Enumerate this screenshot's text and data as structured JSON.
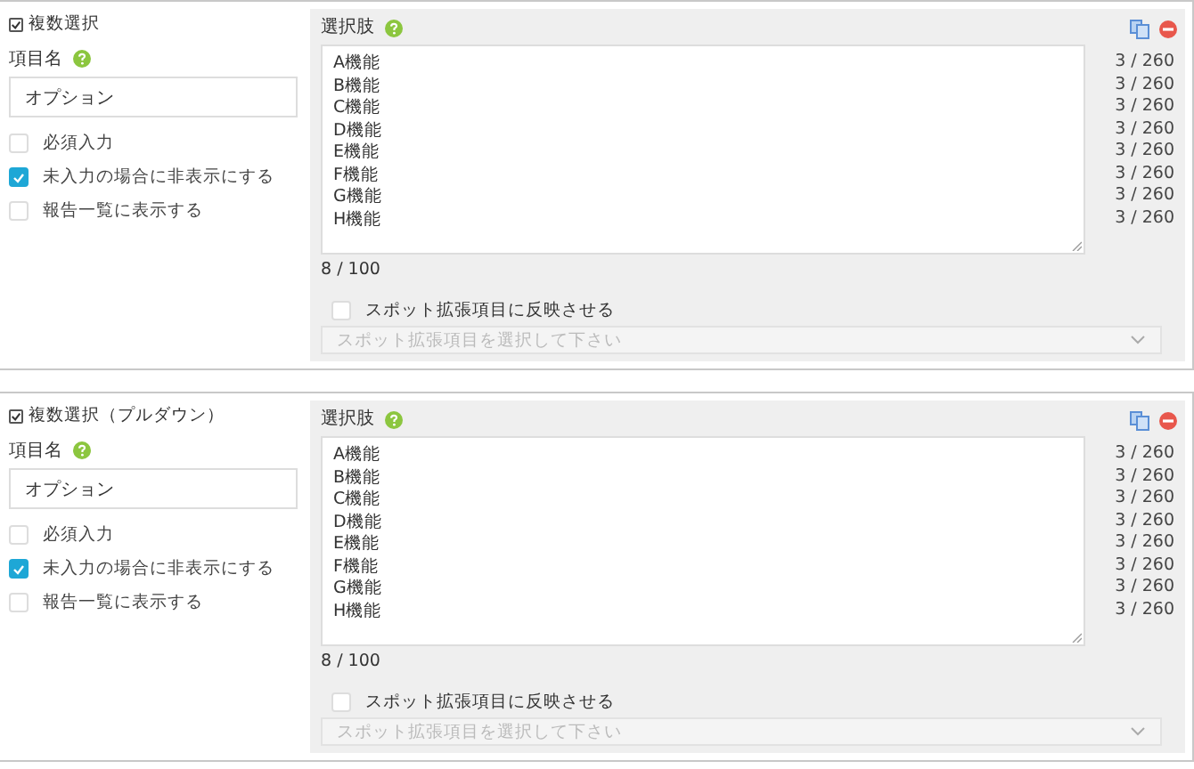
{
  "cards": [
    {
      "heading": {
        "label": "複数選択",
        "checked": true
      },
      "name_label": "項目名",
      "name_value": "オプション",
      "options_flags": [
        {
          "label": "必須入力",
          "checked": false
        },
        {
          "label": "未入力の場合に非表示にする",
          "checked": true
        },
        {
          "label": "報告一覧に表示する",
          "checked": false
        }
      ],
      "choices_label": "選択肢",
      "choices": [
        {
          "text": "A機能",
          "count": "3 / 260"
        },
        {
          "text": "B機能",
          "count": "3 / 260"
        },
        {
          "text": "C機能",
          "count": "3 / 260"
        },
        {
          "text": "D機能",
          "count": "3 / 260"
        },
        {
          "text": "E機能",
          "count": "3 / 260"
        },
        {
          "text": "F機能",
          "count": "3 / 260"
        },
        {
          "text": "G機能",
          "count": "3 / 260"
        },
        {
          "text": "H機能",
          "count": "3 / 260"
        }
      ],
      "total": "8 / 100",
      "spot": {
        "label": "スポット拡張項目に反映させる",
        "checked": false
      },
      "spot_select": {
        "placeholder": "スポット拡張項目を選択して下さい",
        "disabled": true
      }
    },
    {
      "heading": {
        "label": "複数選択（プルダウン）",
        "checked": true
      },
      "name_label": "項目名",
      "name_value": "オプション",
      "options_flags": [
        {
          "label": "必須入力",
          "checked": false
        },
        {
          "label": "未入力の場合に非表示にする",
          "checked": true
        },
        {
          "label": "報告一覧に表示する",
          "checked": false
        }
      ],
      "choices_label": "選択肢",
      "choices": [
        {
          "text": "A機能",
          "count": "3 / 260"
        },
        {
          "text": "B機能",
          "count": "3 / 260"
        },
        {
          "text": "C機能",
          "count": "3 / 260"
        },
        {
          "text": "D機能",
          "count": "3 / 260"
        },
        {
          "text": "E機能",
          "count": "3 / 260"
        },
        {
          "text": "F機能",
          "count": "3 / 260"
        },
        {
          "text": "G機能",
          "count": "3 / 260"
        },
        {
          "text": "H機能",
          "count": "3 / 260"
        }
      ],
      "total": "8 / 100",
      "spot": {
        "label": "スポット拡張項目に反映させる",
        "checked": false
      },
      "spot_select": {
        "placeholder": "スポット拡張項目を選択して下さい",
        "disabled": true
      }
    }
  ]
}
